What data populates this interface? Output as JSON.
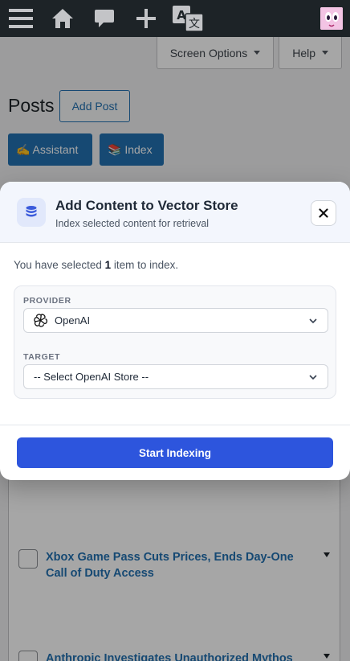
{
  "adminbar": {
    "icons": [
      "menu-icon",
      "home-icon",
      "comment-icon",
      "plus-icon",
      "translate-icon"
    ],
    "avatar_icon": "avatar"
  },
  "screen_meta": {
    "screen_options": "Screen Options",
    "help": "Help"
  },
  "page": {
    "title": "Posts",
    "add_post": "Add Post",
    "assistant": "✍️ Assistant",
    "index": "📚 Index"
  },
  "posts": [
    {
      "title": "Xbox Game Pass Cuts Prices, Ends Day-One Call of Duty Access"
    },
    {
      "title": "Anthropic Investigates Unauthorized Mythos"
    }
  ],
  "modal": {
    "title": "Add Content to Vector Store",
    "subtitle": "Index selected content for retrieval",
    "selected_prefix": "You have selected ",
    "selected_count": "1",
    "selected_suffix": " item to index.",
    "provider_label": "PROVIDER",
    "provider_value": "OpenAI",
    "target_label": "TARGET",
    "target_value": "-- Select OpenAI Store --",
    "start_button": "Start Indexing"
  },
  "colors": {
    "adminbar": "#1d2327",
    "wp_blue": "#2271b1",
    "primary": "#2d55dd"
  }
}
